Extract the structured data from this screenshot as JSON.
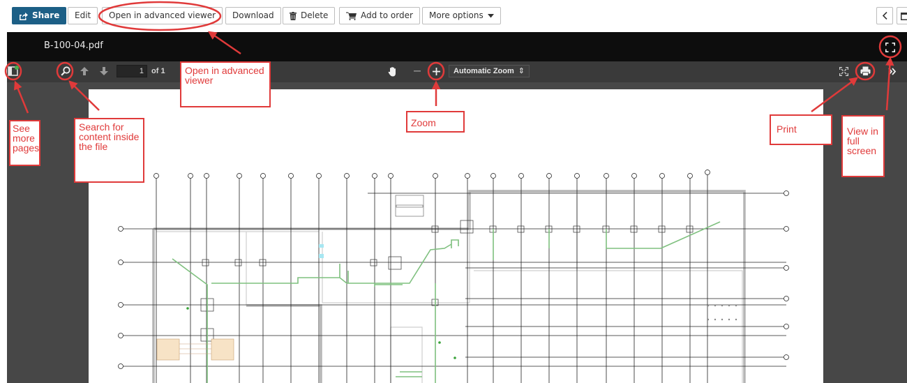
{
  "toolbar": {
    "share_label": "Share",
    "edit_label": "Edit",
    "advanced_viewer_label": "Open in advanced viewer",
    "download_label": "Download",
    "delete_label": "Delete",
    "add_to_order_label": "Add to order",
    "more_options_label": "More options"
  },
  "viewer": {
    "document_title": "B-100-04.pdf",
    "page_number": "1",
    "page_count_label": "of 1",
    "zoom_label": "Automatic Zoom"
  },
  "annotations": {
    "advanced_viewer": "Open in advanced viewer",
    "more_pages": "See more pages",
    "search": "Search for content inside the file",
    "zoom": "Zoom",
    "print": "Print",
    "full_screen": "View in full screen"
  },
  "colors": {
    "primary_button": "#1c5f86",
    "annotation_red": "#e03a3a",
    "viewer_background": "#474747",
    "title_bar": "#0d0d0d",
    "pipe_green": "#7fc07f"
  },
  "icons": {
    "share": "share-icon",
    "delete": "trash-icon",
    "order": "cart-icon",
    "more": "caret-down-icon",
    "sidebar": "sidebar-toggle-icon",
    "search": "search-icon",
    "prev": "arrow-up-icon",
    "next": "arrow-down-icon",
    "hand": "hand-tool-icon",
    "zoom_out": "minus-icon",
    "zoom_in": "plus-icon",
    "presentation": "expand-icon",
    "print": "print-icon",
    "tools": "double-chevron-icon",
    "fullscreen": "fullscreen-icon"
  }
}
